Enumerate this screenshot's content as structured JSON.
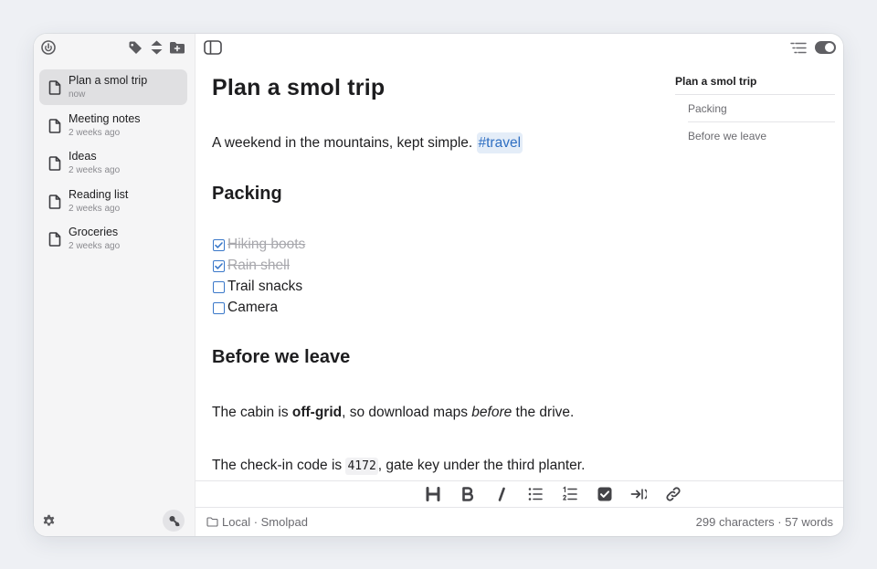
{
  "sidebar": {
    "notes": [
      {
        "title": "Plan a smol trip",
        "time": "now",
        "selected": true
      },
      {
        "title": "Meeting notes",
        "time": "2 weeks ago"
      },
      {
        "title": "Ideas",
        "time": "2 weeks ago"
      },
      {
        "title": "Reading list",
        "time": "2 weeks ago"
      },
      {
        "title": "Groceries",
        "time": "2 weeks ago"
      }
    ]
  },
  "editor": {
    "title": "Plan a smol trip",
    "intro": "A weekend in the mountains, kept simple. ",
    "tag": "#travel",
    "packing_heading": "Packing",
    "tasks": [
      {
        "text": "Hiking boots",
        "done": true
      },
      {
        "text": "Rain shell",
        "done": true
      },
      {
        "text": "Trail snacks",
        "done": false
      },
      {
        "text": "Camera",
        "done": false
      }
    ],
    "leave_heading": "Before we leave",
    "para1": {
      "a": "The cabin is ",
      "b": "off-grid",
      "c": ", so download maps ",
      "d": "before",
      "e": " the drive."
    },
    "para2": {
      "a": "The check-in code is ",
      "code": "4172",
      "b": ", gate key under the third planter."
    }
  },
  "outline": {
    "title": "Plan a smol trip",
    "items": [
      "Packing",
      "Before we leave"
    ]
  },
  "status": {
    "location": "Local · Smolpad",
    "characters": "299 characters",
    "separator": "·",
    "words": "57 words"
  },
  "colors": {
    "accent": "#3a78c9",
    "tag_bg": "#e4edf8",
    "tag_text": "#2f6fc2"
  },
  "icons": [
    "power-icon",
    "tag-icon",
    "sort-icon",
    "new-folder-icon",
    "sidebar-toggle-icon",
    "outline-icon",
    "toggle-switch",
    "settings-icon",
    "account-icon",
    "heading-icon",
    "bold-icon",
    "italic-icon",
    "bullet-list-icon",
    "numbered-list-icon",
    "checkbox-icon",
    "indent-icon",
    "link-icon",
    "folder-icon",
    "document-icon"
  ]
}
